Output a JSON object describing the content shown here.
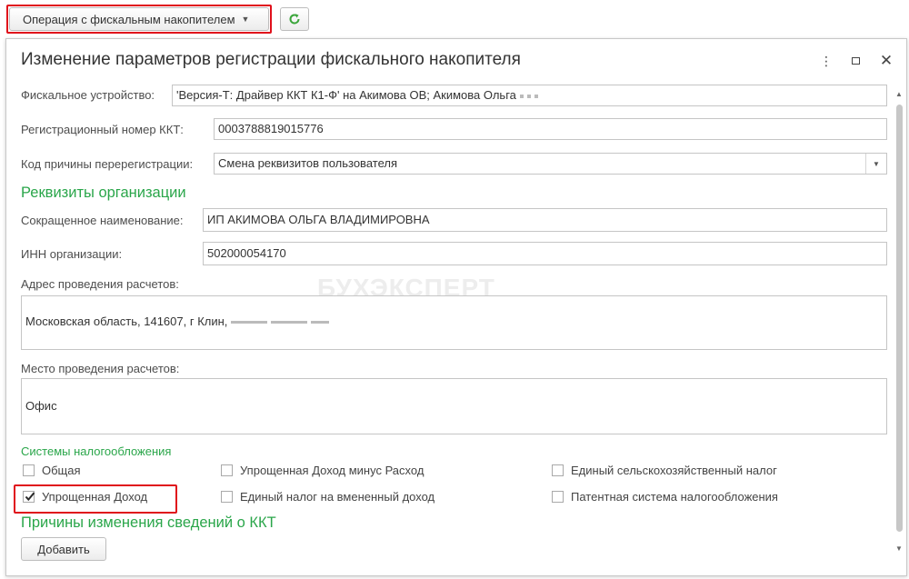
{
  "toolbar": {
    "operation_label": "Операция с фискальным накопителем",
    "refresh_icon": "refresh-icon"
  },
  "dialog": {
    "title": "Изменение параметров регистрации фискального накопителя",
    "controls": [
      "more-icon",
      "maximize-icon",
      "close-icon"
    ],
    "fields": {
      "device": {
        "label": "Фискальное устройство:",
        "value": "'Версия-Т: Драйвер ККТ К1-Ф' на Акимова ОВ; Акимова Ольга"
      },
      "reg_number": {
        "label": "Регистрационный номер ККТ:",
        "value": "0003788819015776"
      },
      "rereg_code": {
        "label": "Код причины перерегистрации:",
        "value": "Смена реквизитов пользователя"
      }
    },
    "org_section": {
      "title": "Реквизиты организации",
      "short_name": {
        "label": "Сокращенное наименование:",
        "value": "ИП АКИМОВА ОЛЬГА ВЛАДИМИРОВНА"
      },
      "inn": {
        "label": "ИНН организации:",
        "value": "502000054170"
      },
      "address": {
        "label": "Адрес проведения расчетов:",
        "value": "Московская область, 141607, г Клин,"
      },
      "place": {
        "label": "Место проведения расчетов:",
        "value": "Офис"
      }
    },
    "tax_section": {
      "title": "Системы налогообложения",
      "options": [
        {
          "label": "Общая",
          "checked": false
        },
        {
          "label": "Упрощенная Доход минус Расход",
          "checked": false
        },
        {
          "label": "Единый сельскохозяйственный налог",
          "checked": false
        },
        {
          "label": "Упрощенная Доход",
          "checked": true
        },
        {
          "label": "Единый налог на вмененный доход",
          "checked": false
        },
        {
          "label": "Патентная система налогообложения",
          "checked": false
        }
      ]
    },
    "reasons_section": {
      "title": "Причины изменения сведений о ККТ",
      "add_label": "Добавить"
    },
    "watermark": "БУХЭКСПЕРТ"
  },
  "colors": {
    "accent_green": "#2aa64a",
    "highlight_red": "#e0101b",
    "refresh_green": "#3aa53a"
  }
}
